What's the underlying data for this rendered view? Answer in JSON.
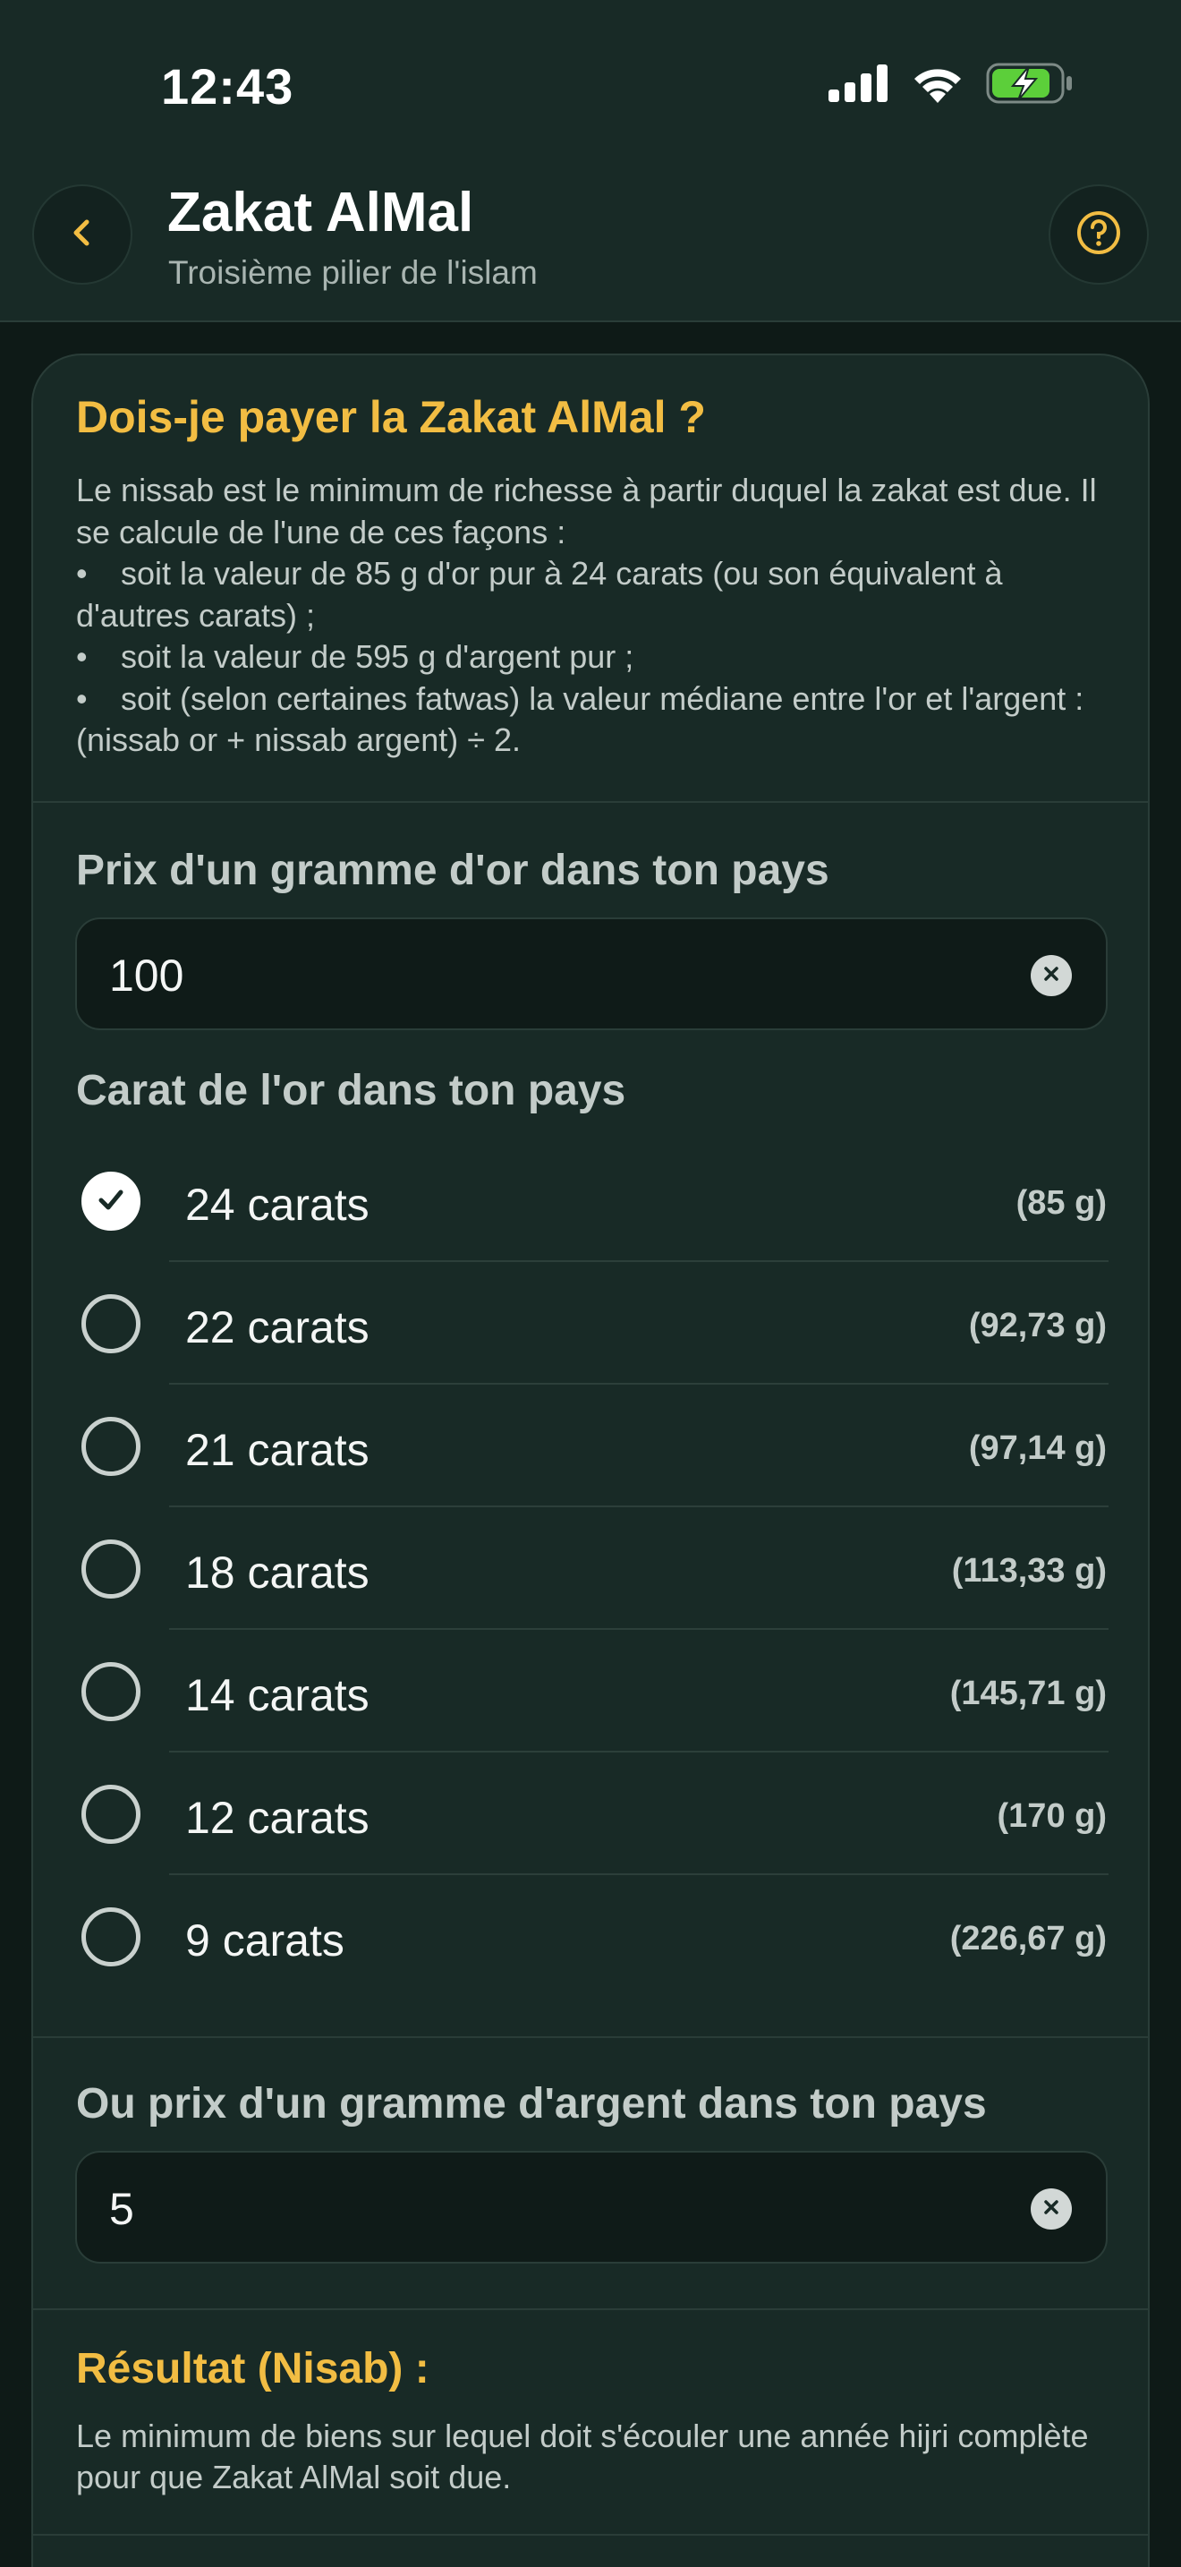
{
  "status_bar": {
    "time": "12:43",
    "icons": [
      "cellular-signal-icon",
      "wifi-icon",
      "battery-charging-icon"
    ],
    "battery_color": "#5ccf3a"
  },
  "header": {
    "title": "Zakat AlMal",
    "subtitle": "Troisième pilier de l'islam",
    "back_icon": "chevron-left-icon",
    "help_icon": "question-mark-icon"
  },
  "intro": {
    "title": "Dois-je payer la Zakat AlMal ?",
    "paragraph": "Le nissab est le minimum de richesse à partir duquel la zakat est due. Il se calcule de l'une de ces façons :",
    "bullets": [
      "soit la valeur de 85 g d'or pur à 24 carats (ou son équivalent à d'autres carats) ;",
      "soit la valeur de 595 g d'argent pur ;",
      "soit (selon certaines fatwas) la valeur médiane entre l'or et l'argent : (nissab or + nissab argent) ÷ 2."
    ],
    "bullet_symbol": "•"
  },
  "gold_price": {
    "label": "Prix d'un gramme d'or dans ton pays",
    "value": "100"
  },
  "carat": {
    "label": "Carat de l'or dans ton pays",
    "selected": "24 carats",
    "options": [
      {
        "label": "24 carats",
        "weight": "(85 g)"
      },
      {
        "label": "22 carats",
        "weight": "(92,73 g)"
      },
      {
        "label": "21 carats",
        "weight": "(97,14 g)"
      },
      {
        "label": "18 carats",
        "weight": "(113,33 g)"
      },
      {
        "label": "14 carats",
        "weight": "(145,71 g)"
      },
      {
        "label": "12 carats",
        "weight": "(170 g)"
      },
      {
        "label": "9 carats",
        "weight": "(226,67 g)"
      }
    ]
  },
  "silver_price": {
    "label": "Ou prix d'un gramme d'argent dans ton pays",
    "value": "5"
  },
  "result": {
    "title": "Résultat (Nisab) :",
    "description": "Le minimum de biens sur lequel doit s'écouler une année hijri complète pour que Zakat AlMal soit due."
  },
  "colors": {
    "accent": "#f2bd43",
    "background": "#0e1a17",
    "card": "#182a26"
  }
}
